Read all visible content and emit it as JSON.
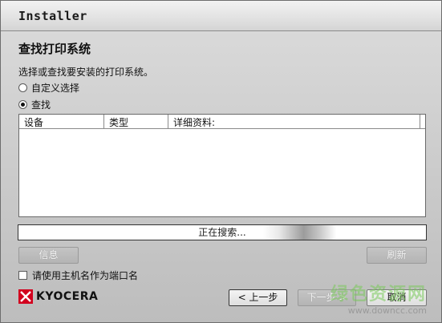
{
  "window": {
    "title": "Installer"
  },
  "page": {
    "title": "查找打印系统",
    "instruction": "选择或查找要安装的打印系统。"
  },
  "options": [
    {
      "label": "自定义选择",
      "selected": false
    },
    {
      "label": "查找",
      "selected": true
    }
  ],
  "table": {
    "columns": [
      "设备",
      "类型",
      "详细资料:"
    ],
    "rows": []
  },
  "status": {
    "text": "正在搜索..."
  },
  "buttons": {
    "info": "信息",
    "refresh": "刷新",
    "back": "< 上一步",
    "next": "下一步 >",
    "cancel": "取消"
  },
  "checkbox": {
    "label": "请使用主机名作为端口名",
    "checked": false
  },
  "brand": {
    "name": "KYOCERA",
    "color": "#d2001e"
  },
  "watermark": {
    "text": "绿色资源网",
    "url": "www.downcc.com"
  }
}
